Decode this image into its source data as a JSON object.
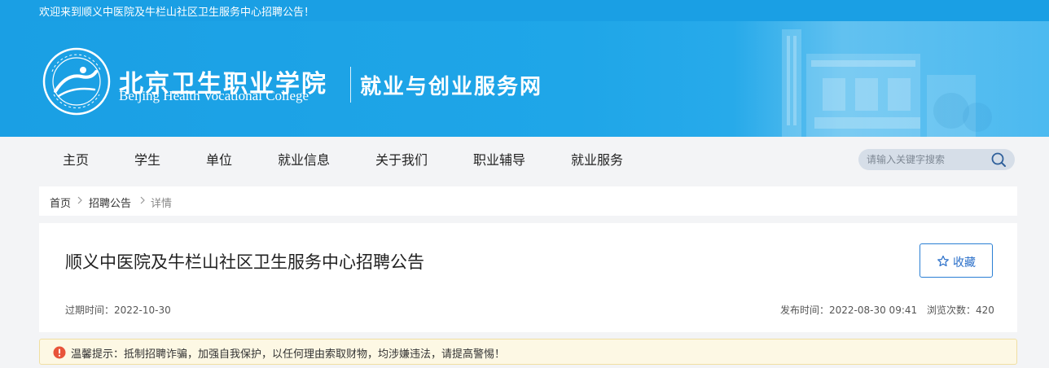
{
  "top_bar": {
    "welcome_text": "欢迎来到顺义中医院及牛栏山社区卫生服务中心招聘公告！"
  },
  "header": {
    "school_name_cn": "北京卫生职业学院",
    "school_name_en": "Beijing Health Vocational College",
    "site_name": "就业与创业服务网",
    "logo_icon": "college-seal-logo",
    "colors": {
      "banner": "#1a9fe4",
      "text": "#ffffff"
    }
  },
  "nav": {
    "items": [
      {
        "label": "主页"
      },
      {
        "label": "学生"
      },
      {
        "label": "单位"
      },
      {
        "label": "就业信息"
      },
      {
        "label": "关于我们"
      },
      {
        "label": "职业辅导"
      },
      {
        "label": "就业服务"
      }
    ],
    "search": {
      "placeholder": "请输入关键字搜索",
      "value": "",
      "icon": "search-icon"
    }
  },
  "breadcrumb": {
    "items": [
      {
        "label": "首页"
      },
      {
        "label": "招聘公告"
      },
      {
        "label": "详情"
      }
    ]
  },
  "article": {
    "title": "顺义中医院及牛栏山社区卫生服务中心招聘公告",
    "favorite_label": "收藏",
    "expire_label": "过期时间：2022-10-30",
    "publish_label": "发布时间：2022-08-30 09:41",
    "views_label": "浏览次数：420",
    "accent_color": "#2a7fd4"
  },
  "warning": {
    "text": "温馨提示：抵制招聘诈骗，加强自我保护，以任何理由索取财物，均涉嫌违法，请提高警惕！",
    "icon": "alert-circle-icon",
    "colors": {
      "background": "#fdf8e4",
      "icon": "#e8543a"
    }
  }
}
